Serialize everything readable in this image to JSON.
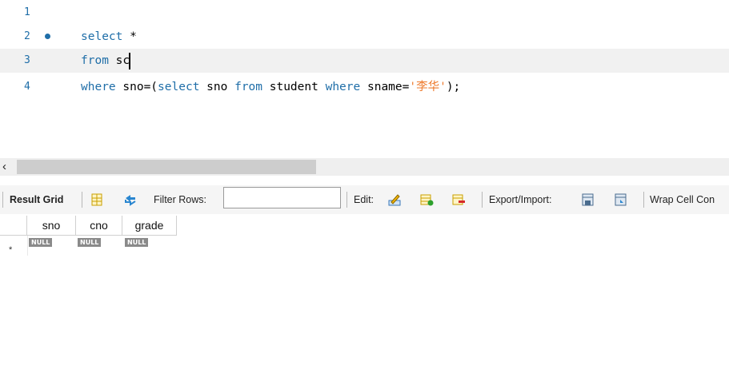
{
  "editor": {
    "lines": [
      {
        "num": "1",
        "tokens": []
      },
      {
        "num": "2",
        "tokens": [
          {
            "t": "select",
            "k": "kw"
          },
          {
            "t": " *",
            "k": ""
          }
        ]
      },
      {
        "num": "3",
        "tokens": [
          {
            "t": "from",
            "k": "kw"
          },
          {
            "t": " sc",
            "k": ""
          }
        ]
      },
      {
        "num": "4",
        "tokens": [
          {
            "t": "where",
            "k": "kw"
          },
          {
            "t": " sno=(",
            "k": ""
          },
          {
            "t": "select",
            "k": "kw"
          },
          {
            "t": " sno ",
            "k": ""
          },
          {
            "t": "from",
            "k": "kw"
          },
          {
            "t": " student ",
            "k": ""
          },
          {
            "t": "where",
            "k": "kw"
          },
          {
            "t": " sname=",
            "k": ""
          },
          {
            "t": "'李华'",
            "k": "str"
          },
          {
            "t": ");",
            "k": ""
          }
        ]
      }
    ]
  },
  "toolbar": {
    "result_grid": "Result Grid",
    "filter_label": "Filter Rows:",
    "filter_value": "",
    "edit_label": "Edit:",
    "export_label": "Export/Import:",
    "wrap_label": "Wrap Cell Con"
  },
  "grid": {
    "columns": [
      "sno",
      "cno",
      "grade"
    ],
    "row_marker": "*",
    "null_badge": "NULL"
  },
  "colors": {
    "keyword": "#1f6ea8",
    "string": "#ee7b2e",
    "line_number": "#1f6ea8"
  }
}
